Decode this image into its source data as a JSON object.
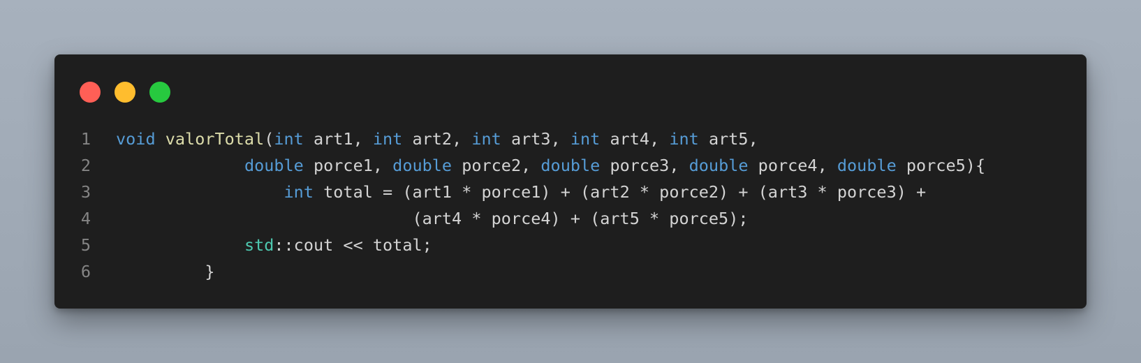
{
  "window": {
    "controls": [
      {
        "name": "close",
        "color": "#ff5f56"
      },
      {
        "name": "minimize",
        "color": "#ffbd2e"
      },
      {
        "name": "maximize",
        "color": "#27c93f"
      }
    ]
  },
  "theme": {
    "background": "#1e1e1e",
    "keyword": "#569cd6",
    "function": "#dcdcaa",
    "namespace": "#4ec9b0",
    "text": "#d4d4d4",
    "line_number": "#858585"
  },
  "code": {
    "language": "cpp",
    "lines": [
      {
        "number": "1",
        "tokens": [
          {
            "t": "void",
            "c": "kw"
          },
          {
            "t": " ",
            "c": "tx"
          },
          {
            "t": "valorTotal",
            "c": "fn"
          },
          {
            "t": "(",
            "c": "tx"
          },
          {
            "t": "int",
            "c": "kw"
          },
          {
            "t": " art1, ",
            "c": "tx"
          },
          {
            "t": "int",
            "c": "kw"
          },
          {
            "t": " art2, ",
            "c": "tx"
          },
          {
            "t": "int",
            "c": "kw"
          },
          {
            "t": " art3, ",
            "c": "tx"
          },
          {
            "t": "int",
            "c": "kw"
          },
          {
            "t": " art4, ",
            "c": "tx"
          },
          {
            "t": "int",
            "c": "kw"
          },
          {
            "t": " art5,",
            "c": "tx"
          }
        ]
      },
      {
        "number": "2",
        "tokens": [
          {
            "t": "             ",
            "c": "tx"
          },
          {
            "t": "double",
            "c": "kw"
          },
          {
            "t": " porce1, ",
            "c": "tx"
          },
          {
            "t": "double",
            "c": "kw"
          },
          {
            "t": " porce2, ",
            "c": "tx"
          },
          {
            "t": "double",
            "c": "kw"
          },
          {
            "t": " porce3, ",
            "c": "tx"
          },
          {
            "t": "double",
            "c": "kw"
          },
          {
            "t": " porce4, ",
            "c": "tx"
          },
          {
            "t": "double",
            "c": "kw"
          },
          {
            "t": " porce5){",
            "c": "tx"
          }
        ]
      },
      {
        "number": "3",
        "tokens": [
          {
            "t": "                 ",
            "c": "tx"
          },
          {
            "t": "int",
            "c": "kw"
          },
          {
            "t": " total = (art1 * porce1) + (art2 * porce2) + (art3 * porce3) +",
            "c": "tx"
          }
        ]
      },
      {
        "number": "4",
        "tokens": [
          {
            "t": "                              (art4 * porce4) + (art5 * porce5);",
            "c": "tx"
          }
        ]
      },
      {
        "number": "5",
        "tokens": [
          {
            "t": "             ",
            "c": "tx"
          },
          {
            "t": "std",
            "c": "ns"
          },
          {
            "t": "::cout << total;",
            "c": "tx"
          }
        ]
      },
      {
        "number": "6",
        "tokens": [
          {
            "t": "         }",
            "c": "tx"
          }
        ]
      }
    ]
  }
}
